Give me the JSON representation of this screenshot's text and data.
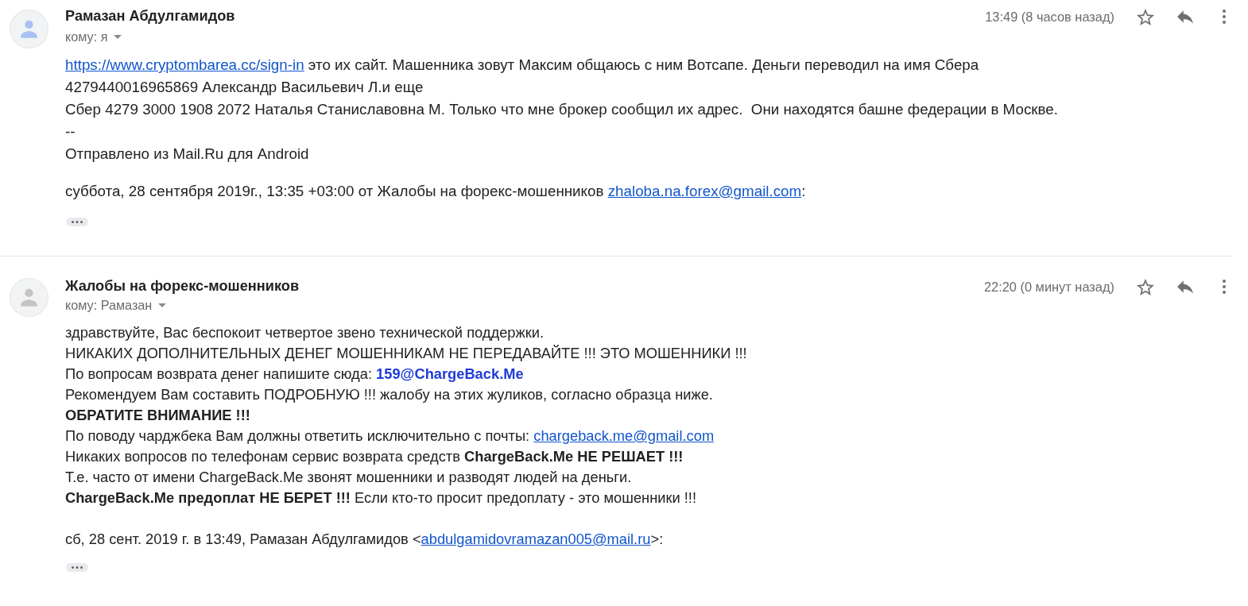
{
  "messages": [
    {
      "sender": "Рамазан Абдулгамидов",
      "recipient": "кому: я",
      "time": "13:49 (8 часов назад)",
      "starred": false,
      "color": "#a8c1f3",
      "body": [
        [
          {
            "kind": "link",
            "text": "https://www.cryptombarea.cc/sign-in"
          },
          {
            "kind": "text",
            "text": " это их сайт. Машенника зовут Максим общаюсь с ним Вотсапе. Деньги переводил на имя Сбера"
          }
        ],
        [
          {
            "kind": "text",
            "text": "4279440016965869 Александр Васильевич Л.и еще"
          }
        ],
        [
          {
            "kind": "text",
            "text": "Сбер 4279 3000 1908 2072 Наталья Станиславовна М. Только что мне брокер сообщил их адрес.  Они находятся башне федерации в Москве."
          }
        ],
        [
          {
            "kind": "text",
            "text": "--"
          }
        ],
        [
          {
            "kind": "text",
            "text": "Отправлено из Mail.Ru для Android"
          }
        ]
      ],
      "quote": [
        {
          "kind": "text",
          "text": "суббота, 28 сентября 2019г., 13:35 +03:00 от Жалобы на форекс-мошенников "
        },
        {
          "kind": "link",
          "text": "zhaloba.na.forex@gmail.com"
        },
        {
          "kind": "text",
          "text": ":"
        }
      ]
    },
    {
      "sender": "Жалобы на форекс-мошенников",
      "recipient": "кому: Рамазан",
      "time": "22:20 (0 минут назад)",
      "starred": false,
      "color": "#c4c4c4",
      "body": [
        [
          {
            "kind": "text",
            "text": "здравствуйте, Вас беспокоит четвертое звено технической поддержки."
          }
        ],
        [
          {
            "kind": "text",
            "text": "НИКАКИХ ДОПОЛНИТЕЛЬНЫХ ДЕНЕГ МОШЕННИКАМ НЕ ПЕРЕДАВАЙТЕ !!! ЭТО МОШЕННИКИ !!!"
          }
        ],
        [
          {
            "kind": "text",
            "text": "По вопросам возврата денег напишите сюда: "
          },
          {
            "kind": "highlight",
            "text": "159@ChargeBack.Me"
          }
        ],
        [
          {
            "kind": "text",
            "text": "Рекомендуем Вам составить ПОДРОБНУЮ !!! жалобу на этих жуликов, согласно образца ниже."
          }
        ],
        [
          {
            "kind": "strong",
            "text": "ОБРАТИТЕ ВНИМАНИЕ !!!"
          }
        ],
        [
          {
            "kind": "text",
            "text": "По поводу чарджбека Вам должны ответить исключительно с почты: "
          },
          {
            "kind": "link",
            "text": "chargeback.me@gmail.com"
          }
        ],
        [
          {
            "kind": "text",
            "text": "Никаких вопросов по телефонам сервис возврата средств **ChargeBack.Me НЕ РЕШАЕТ !!!**"
          }
        ],
        [
          {
            "kind": "text",
            "text": "Т.е. часто от имени ChargeBack.Me звонят мошенники и разводят людей на деньги."
          }
        ],
        [
          {
            "kind": "text",
            "text": "**ChargeBack.Me предоплат НЕ БЕРЕТ !!!** Если кто-то просит предоплату - это мошенники !!!"
          }
        ]
      ],
      "quote": [
        {
          "kind": "text",
          "text": "сб, 28 сент. 2019 г. в 13:49, Рамазан Абдулгамидов <"
        },
        {
          "kind": "link",
          "text": "abdulgamidovramazan005@mail.ru"
        },
        {
          "kind": "text",
          "text": ">:"
        }
      ]
    }
  ]
}
